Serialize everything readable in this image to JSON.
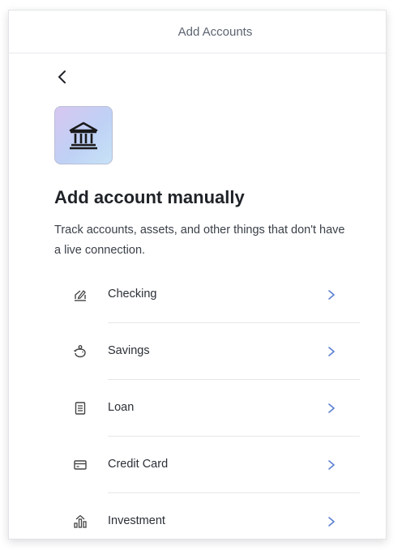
{
  "header": {
    "title": "Add Accounts"
  },
  "page": {
    "heading": "Add account manually",
    "description": "Track accounts, assets, and other things that don't have a live connection."
  },
  "accounts": [
    {
      "label": "Checking",
      "icon": "checkbook-icon"
    },
    {
      "label": "Savings",
      "icon": "piggy-bank-icon"
    },
    {
      "label": "Loan",
      "icon": "document-icon"
    },
    {
      "label": "Credit Card",
      "icon": "credit-card-icon"
    },
    {
      "label": "Investment",
      "icon": "investment-icon"
    }
  ],
  "colors": {
    "chevron": "#5b7fd1",
    "icon_tile_gradient": [
      "#d7c6f0",
      "#bfd1f5",
      "#c7e3f7"
    ]
  }
}
